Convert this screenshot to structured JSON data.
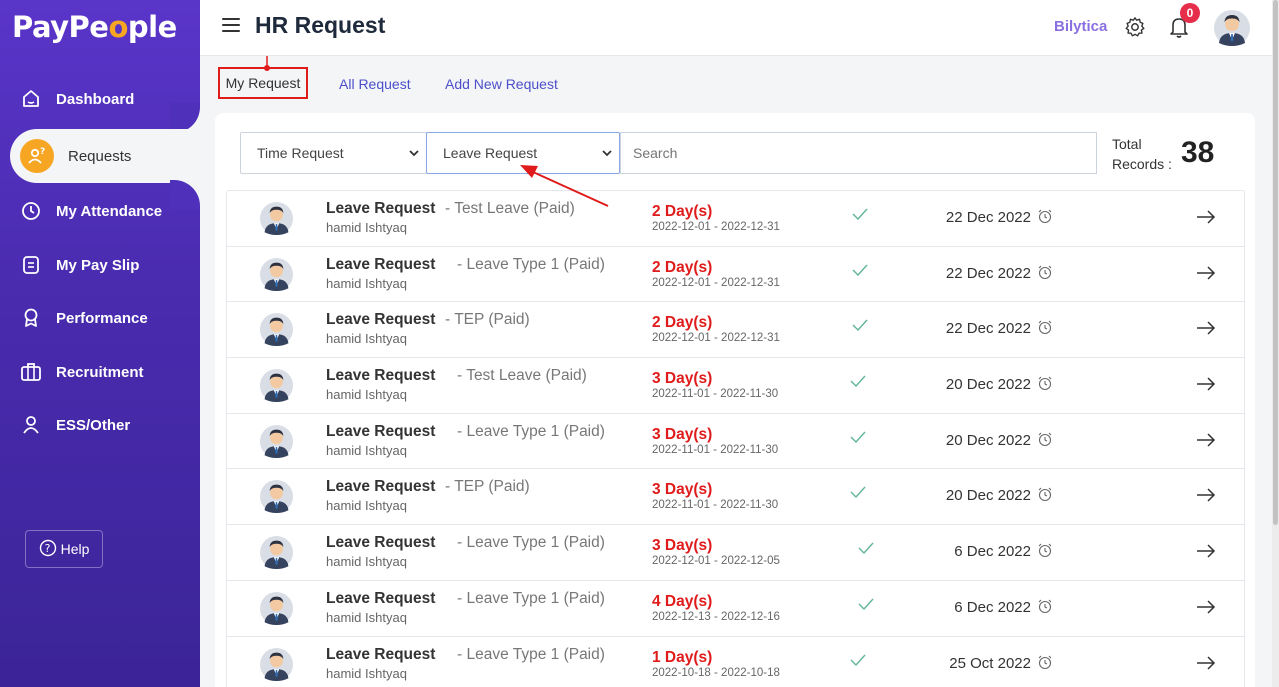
{
  "brand": {
    "name_pre": "PayPe",
    "name_o": "o",
    "name_post": "ple"
  },
  "sidebar": {
    "items": [
      {
        "label": "Dashboard"
      },
      {
        "label": "Requests"
      },
      {
        "label": "My Attendance"
      },
      {
        "label": "My Pay Slip"
      },
      {
        "label": "Performance"
      },
      {
        "label": "Recruitment"
      },
      {
        "label": "ESS/Other"
      }
    ],
    "help_label": "Help"
  },
  "header": {
    "title": "HR Request",
    "company": "Bilytica",
    "notification_count": "0"
  },
  "tabs": {
    "my": "My Request",
    "all": "All Request",
    "add": "Add New Request"
  },
  "filters": {
    "type_value": "Time Request",
    "leave_value": "Leave Request",
    "search_placeholder": "Search",
    "total_label_1": "Total",
    "total_label_2": "Records :",
    "total_value": "38"
  },
  "rows": [
    {
      "type": "Leave Request",
      "leave": "- Test Leave (Paid)",
      "employee": "hamid Ishtyaq",
      "days": "2 Day(s)",
      "range": "2022-12-01 - 2022-12-31",
      "date": "22 Dec 2022"
    },
    {
      "type": "Leave Request",
      "leave": "- Leave Type 1 (Paid)",
      "employee": "hamid Ishtyaq",
      "days": "2 Day(s)",
      "range": "2022-12-01 - 2022-12-31",
      "date": "22 Dec 2022"
    },
    {
      "type": "Leave Request",
      "leave": "- TEP (Paid)",
      "employee": "hamid Ishtyaq",
      "days": "2 Day(s)",
      "range": "2022-12-01 - 2022-12-31",
      "date": "22 Dec 2022"
    },
    {
      "type": "Leave Request",
      "leave": "- Test Leave (Paid)",
      "employee": "hamid Ishtyaq",
      "days": "3 Day(s)",
      "range": "2022-11-01 - 2022-11-30",
      "date": "20 Dec 2022"
    },
    {
      "type": "Leave Request",
      "leave": "- Leave Type 1 (Paid)",
      "employee": "hamid Ishtyaq",
      "days": "3 Day(s)",
      "range": "2022-11-01 - 2022-11-30",
      "date": "20 Dec 2022"
    },
    {
      "type": "Leave Request",
      "leave": "- TEP (Paid)",
      "employee": "hamid Ishtyaq",
      "days": "3 Day(s)",
      "range": "2022-11-01 - 2022-11-30",
      "date": "20 Dec 2022"
    },
    {
      "type": "Leave Request",
      "leave": "- Leave Type 1 (Paid)",
      "employee": "hamid Ishtyaq",
      "days": "3 Day(s)",
      "range": "2022-12-01 - 2022-12-05",
      "date": "6 Dec 2022"
    },
    {
      "type": "Leave Request",
      "leave": "- Leave Type 1 (Paid)",
      "employee": "hamid Ishtyaq",
      "days": "4 Day(s)",
      "range": "2022-12-13 - 2022-12-16",
      "date": "6 Dec 2022"
    },
    {
      "type": "Leave Request",
      "leave": "- Leave Type 1 (Paid)",
      "employee": "hamid Ishtyaq",
      "days": "1 Day(s)",
      "range": "2022-10-18 - 2022-10-18",
      "date": "25 Oct 2022"
    }
  ],
  "icons": {
    "dashboard": "home-icon",
    "requests": "requests-icon",
    "attendance": "clock-icon",
    "payslip": "document-icon",
    "performance": "award-icon",
    "recruitment": "briefcase-icon",
    "ess": "user-icon",
    "help": "question-circle-icon",
    "check": "check-icon",
    "clock": "alarm-clock-icon",
    "arrow": "arrow-right-icon"
  },
  "colors": {
    "sidebar": "#4f30bb",
    "accent": "#f6a623",
    "days_text": "#e01b1b",
    "link": "#4b4fc9",
    "check": "#5fb39a"
  }
}
